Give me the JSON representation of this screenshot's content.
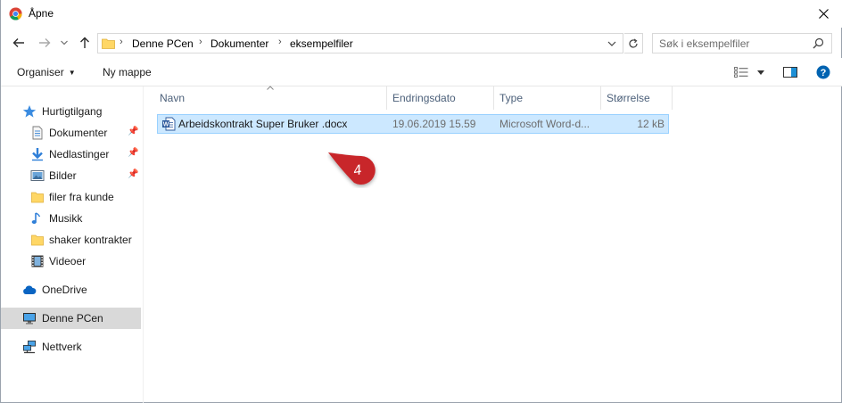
{
  "window": {
    "title": "Åpne",
    "close_label": "✕"
  },
  "nav": {
    "back": "←",
    "forward": "→",
    "recent": "⌄",
    "up": "↑",
    "breadcrumb": [
      "Denne PCen",
      "Dokumenter",
      "eksempelfiler"
    ],
    "separator": "›",
    "search_placeholder": "Søk i eksempelfiler"
  },
  "toolbar": {
    "organize": "Organiser",
    "new_folder": "Ny mappe"
  },
  "sidebar": {
    "items": [
      {
        "label": "Hurtigtilgang",
        "icon": "star-icon",
        "pinned": false
      },
      {
        "label": "Dokumenter",
        "icon": "documents-icon",
        "pinned": true
      },
      {
        "label": "Nedlastinger",
        "icon": "download-icon",
        "pinned": true
      },
      {
        "label": "Bilder",
        "icon": "pictures-icon",
        "pinned": true
      },
      {
        "label": "filer fra kunde",
        "icon": "folder-icon",
        "pinned": false
      },
      {
        "label": "Musikk",
        "icon": "music-icon",
        "pinned": false
      },
      {
        "label": "shaker kontrakter",
        "icon": "folder-icon",
        "pinned": false
      },
      {
        "label": "Videoer",
        "icon": "video-icon",
        "pinned": false
      },
      {
        "label": "OneDrive",
        "icon": "cloud-icon",
        "pinned": false
      },
      {
        "label": "Denne PCen",
        "icon": "computer-icon",
        "pinned": false,
        "selected": true
      },
      {
        "label": "Nettverk",
        "icon": "network-icon",
        "pinned": false
      }
    ]
  },
  "table": {
    "columns": [
      "Navn",
      "Endringsdato",
      "Type",
      "Størrelse"
    ],
    "rows": [
      {
        "name": "Arbeidskontrakt Super Bruker .docx",
        "date": "19.06.2019 15.59",
        "type": "Microsoft Word-d...",
        "size": "12 kB",
        "selected": true
      }
    ]
  },
  "annotation": {
    "step": "4",
    "color": "#c8262c"
  },
  "colors": {
    "accent": "#0078d7",
    "selection_bg": "#cce8ff",
    "selection_border": "#99d1ff",
    "nav_selected": "#d9d9d9",
    "header_text": "#4c607a",
    "muted_text": "#6d6d6d"
  }
}
